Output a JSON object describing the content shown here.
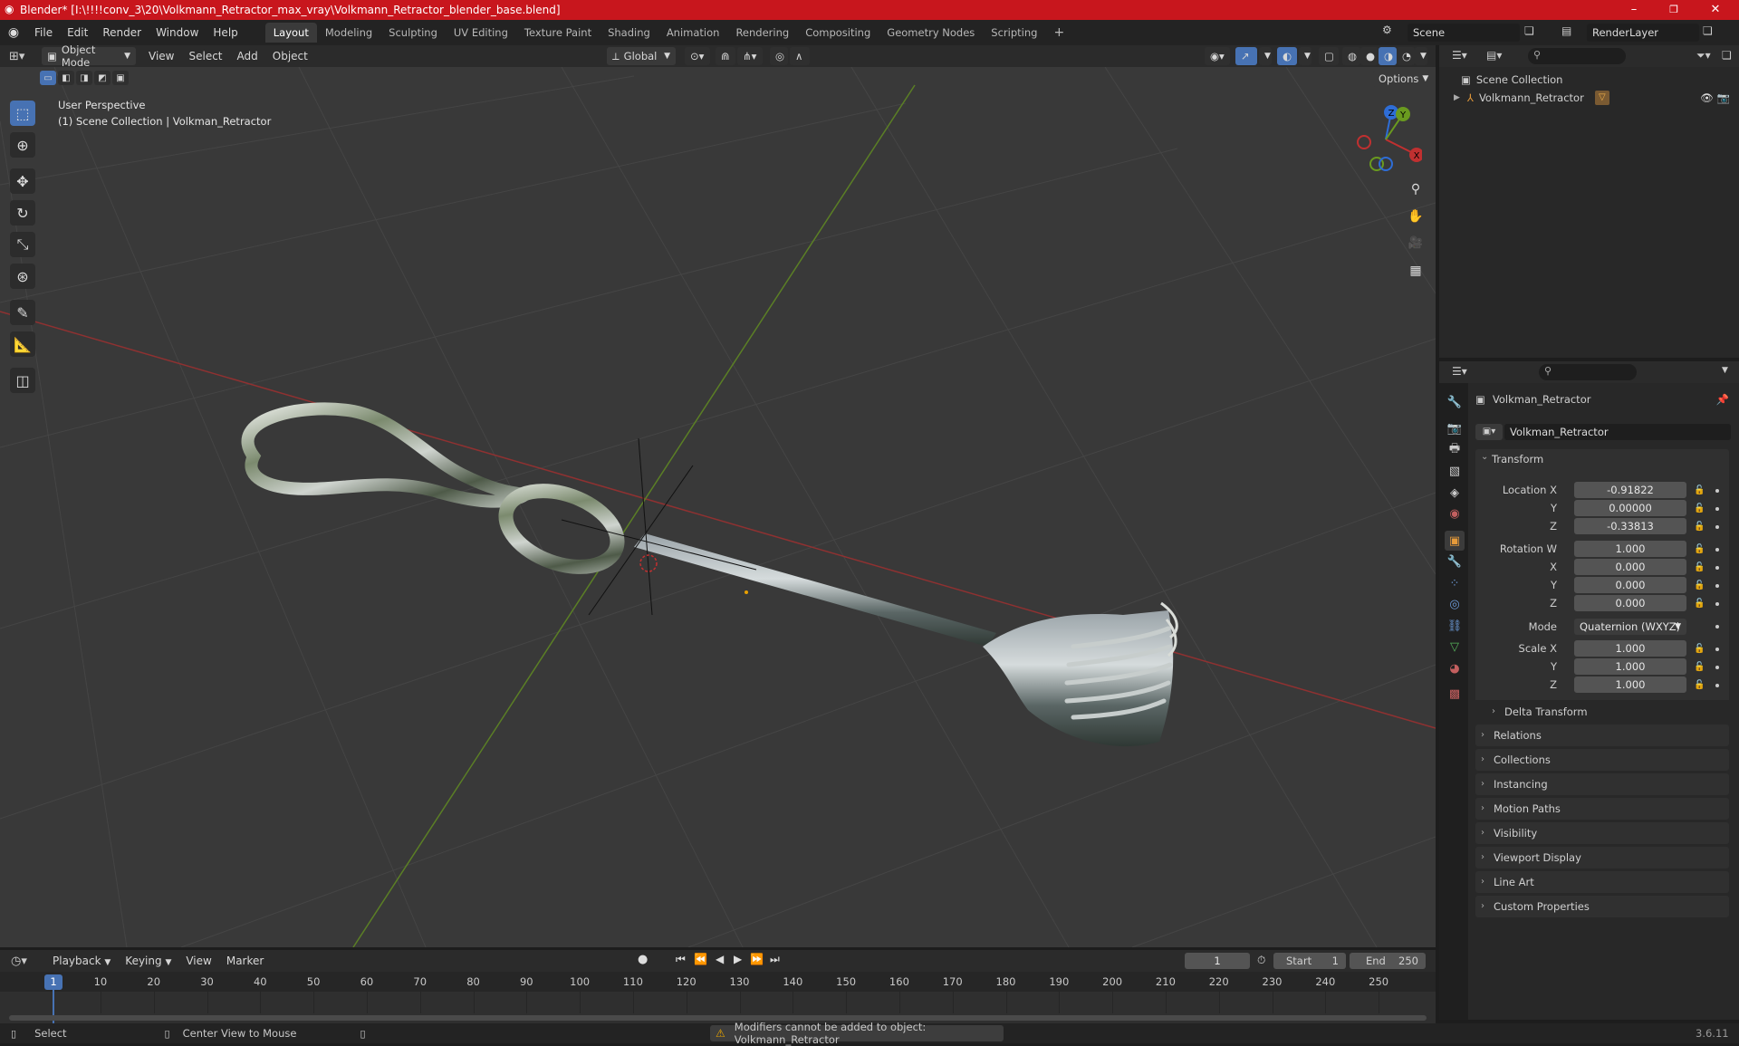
{
  "window": {
    "title": "Blender* [I:\\!!!!conv_3\\20\\Volkmann_Retractor_max_vray\\Volkmann_Retractor_blender_base.blend]",
    "minimize": "–",
    "maximize": "❐",
    "close": "✕"
  },
  "menu": {
    "items": [
      "File",
      "Edit",
      "Render",
      "Window",
      "Help"
    ],
    "workspaces": [
      "Layout",
      "Modeling",
      "Sculpting",
      "UV Editing",
      "Texture Paint",
      "Shading",
      "Animation",
      "Rendering",
      "Compositing",
      "Geometry Nodes",
      "Scripting"
    ],
    "add_tab": "+",
    "scene": "Scene",
    "view_layer": "RenderLayer"
  },
  "viewport_header": {
    "mode": "Object Mode",
    "menus": [
      "View",
      "Select",
      "Add",
      "Object"
    ],
    "orientation": "Global",
    "options": "Options"
  },
  "viewport": {
    "perspective": "User Perspective",
    "collection_info": "(1) Scene Collection | Volkman_Retractor",
    "gizmo": {
      "z": "Z",
      "y": "Y",
      "x": "X"
    }
  },
  "outliner": {
    "root": "Scene Collection",
    "object": "Volkmann_Retractor"
  },
  "properties": {
    "object_name": "Volkman_Retractor",
    "data_name": "Volkman_Retractor",
    "transform_title": "Transform",
    "location_label": "Location X",
    "location": {
      "x": "-0.91822",
      "y": "0.00000",
      "z": "-0.33813"
    },
    "rotation_label": "Rotation W",
    "rotation": {
      "w": "1.000",
      "x": "0.000",
      "y": "0.000",
      "z": "0.000"
    },
    "axis_y": "Y",
    "axis_z": "Z",
    "axis_x": "X",
    "mode_label": "Mode",
    "mode_value": "Quaternion (WXYZ)",
    "scale_label": "Scale X",
    "scale": {
      "x": "1.000",
      "y": "1.000",
      "z": "1.000"
    },
    "delta_transform": "Delta Transform",
    "panels": [
      "Relations",
      "Collections",
      "Instancing",
      "Motion Paths",
      "Visibility",
      "Viewport Display",
      "Line Art",
      "Custom Properties"
    ]
  },
  "timeline": {
    "menus": [
      "Playback",
      "Keying",
      "View",
      "Marker"
    ],
    "current_frame": "1",
    "start_label": "Start",
    "start": "1",
    "end_label": "End",
    "end": "250",
    "current_marker": "1",
    "ticks": [
      "10",
      "20",
      "30",
      "40",
      "50",
      "60",
      "70",
      "80",
      "90",
      "100",
      "110",
      "120",
      "130",
      "140",
      "150",
      "160",
      "170",
      "180",
      "190",
      "200",
      "210",
      "220",
      "230",
      "240",
      "250"
    ]
  },
  "status": {
    "select": "Select",
    "center_view": "Center View to Mouse",
    "warning": "Modifiers cannot be added to object: Volkmann_Retractor",
    "version": "3.6.11"
  },
  "colors": {
    "title_bar": "#c8161d",
    "active_blue": "#4772b3",
    "x_axis": "#c03030",
    "y_axis": "#6a9a1f",
    "z_axis": "#2e6dd6",
    "warning": "#e8a400"
  }
}
